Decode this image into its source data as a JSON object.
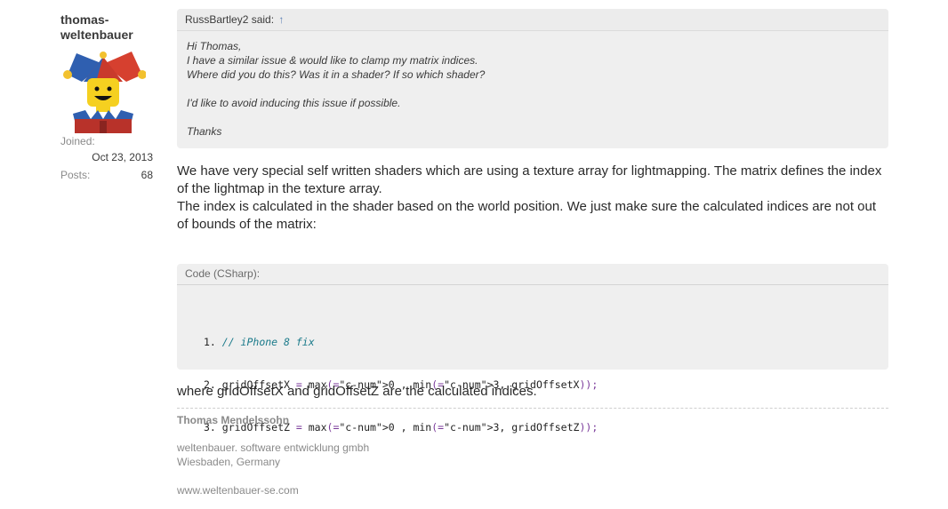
{
  "author": {
    "name": "thomas-weltenbauer",
    "name_line1": "thomas-",
    "name_line2": "weltenbauer",
    "joined_label": "Joined:",
    "joined_value": "Oct 23, 2013",
    "posts_label": "Posts:",
    "posts_value": "68"
  },
  "quote": {
    "attribution": "RussBartley2 said:",
    "jump_icon": "up-arrow-icon",
    "lines": [
      "Hi Thomas,",
      "I have a similar issue & would like to clamp my matrix indices.",
      "Where did you do this? Was it in a shader? If so which shader?",
      "",
      "I'd like to avoid inducing this issue if possible.",
      "",
      "Thanks"
    ]
  },
  "message": {
    "paragraph1": "We have very special self written shaders which are using a texture array for lightmapping. The matrix defines the index of the lightmap in the texture array.",
    "paragraph2": "The index is calculated in the shader based on the world position. We just make sure the calculated indices are not out of bounds of the matrix:",
    "after_code": "where gridOffsetX and gridOffsetZ are the calculated indices."
  },
  "code": {
    "title": "Code (CSharp):",
    "lines": [
      "1. // iPhone 8 fix",
      "2. gridOffsetX = max(0 , min(3, gridOffsetX));",
      "3. gridOffsetZ = max(0 , min(3, gridOffsetZ));"
    ]
  },
  "signature": {
    "name": "Thomas Mendelssohn",
    "company": "weltenbauer. software entwicklung gmbh",
    "location": "Wiesbaden, Germany",
    "website": "www.weltenbauer-se.com"
  }
}
